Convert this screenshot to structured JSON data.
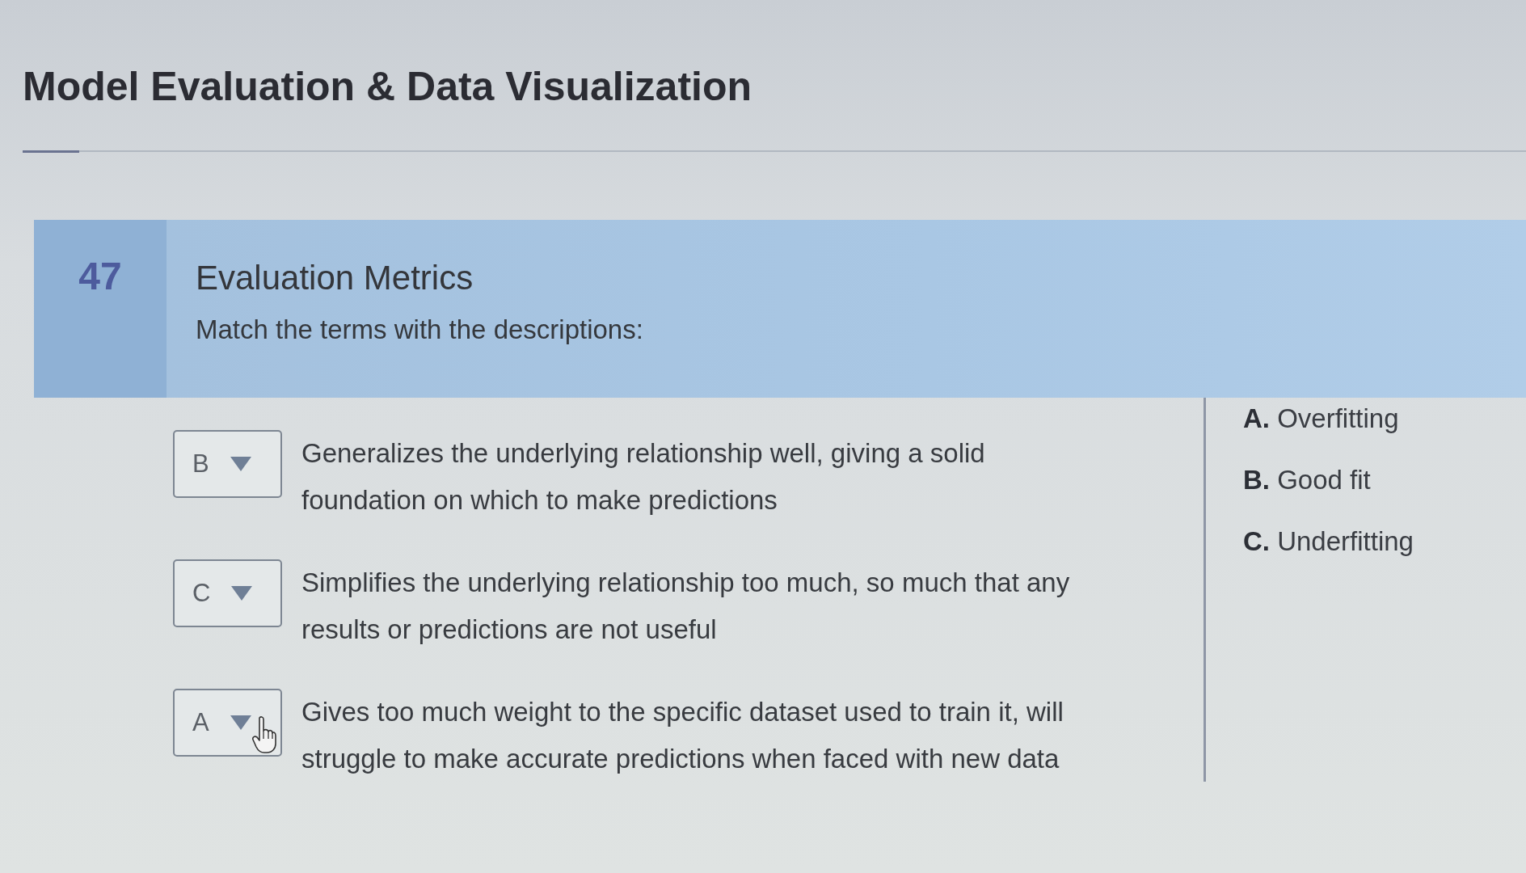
{
  "page": {
    "title": "Model Evaluation & Data Visualization"
  },
  "question": {
    "number": "47",
    "title": "Evaluation Metrics",
    "prompt": "Match the terms with the descriptions:"
  },
  "matches": [
    {
      "answer": "B",
      "description": "Generalizes the underlying relationship well, giving a solid foundation on which to make predictions",
      "hovered": false
    },
    {
      "answer": "C",
      "description": "Simplifies the underlying relationship too much, so much that any results or predictions are not useful",
      "hovered": false
    },
    {
      "answer": "A",
      "description": "Gives too much weight to the specific dataset used to train it, will struggle to make accurate predictions when faced with new data",
      "hovered": true
    }
  ],
  "options": [
    {
      "letter": "A.",
      "text": "Overfitting"
    },
    {
      "letter": "B.",
      "text": "Good fit"
    },
    {
      "letter": "C.",
      "text": "Underfitting"
    }
  ]
}
